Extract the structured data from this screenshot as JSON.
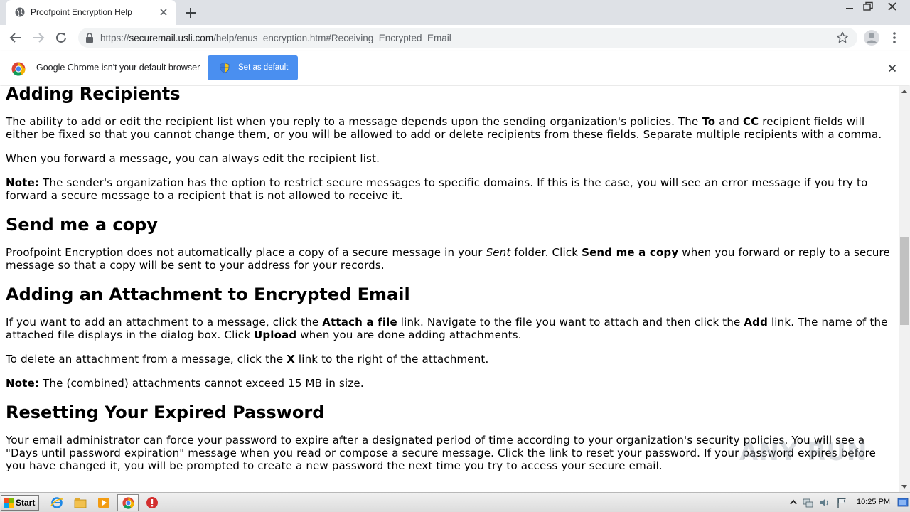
{
  "browser": {
    "tab": {
      "title": "Proofpoint Encryption Help"
    },
    "address": {
      "scheme": "https://",
      "host": "securemail.usli.com",
      "path": "/help/enus_encryption.htm#Receiving_Encrypted_Email"
    }
  },
  "infobar": {
    "message": "Google Chrome isn't your default browser",
    "button_label": "Set as default"
  },
  "content": {
    "sections": [
      {
        "heading": "Adding Recipients",
        "paragraphs": [
          {
            "a": "The ability to add or edit the recipient list when you reply to a message depends upon the sending organization's policies. The ",
            "b1": "To",
            "c": " and ",
            "b2": "CC",
            "d": " recipient fields will either be fixed so that you cannot change them, or you will be allowed to add or delete recipients from these fields. Separate multiple recipients with a comma."
          },
          {
            "text": "When you forward a message, you can always edit the recipient list."
          },
          {
            "label": "Note:",
            "text": " The sender's organization has the option to restrict secure messages to specific domains. If this is the case, you will see an error message if you try to forward a secure message to a recipient that is not allowed to receive it."
          }
        ]
      },
      {
        "heading": "Send me a copy",
        "paragraphs": [
          {
            "a": "Proofpoint Encryption does not automatically place a copy of a secure message in your ",
            "i1": "Sent",
            "c": " folder. Click ",
            "b1": "Send me a copy",
            "d": " when you forward or reply to a secure message so that a copy will be sent to your address for your records."
          }
        ]
      },
      {
        "heading": "Adding an Attachment to Encrypted Email",
        "paragraphs": [
          {
            "a": "If you want to add an attachment to a message, click the ",
            "b1": "Attach a file",
            "c": " link. Navigate to the file you want to attach and then click the ",
            "b2": "Add",
            "d": " link. The name of the attached file displays in the dialog box. Click ",
            "b3": "Upload",
            "e": " when you are done adding attachments."
          },
          {
            "a": "To delete an attachment from a message, click the ",
            "b1": "X",
            "c": " link to the right of the attachment."
          },
          {
            "label": "Note:",
            "text": " The (combined) attachments cannot exceed 15 MB in size."
          }
        ]
      },
      {
        "heading": "Resetting Your Expired Password",
        "paragraphs": [
          {
            "text": "Your email administrator can force your password to expire after a designated period of time according to your organization's security policies. You will see a \"Days until password expiration\" message when you read or compose a secure message. Click the link to reset your password. If your password expires before you have changed it, you will be prompted to create a new password the next time you try to access your secure email."
          }
        ]
      }
    ]
  },
  "watermark": {
    "text": "ANY RUN"
  },
  "taskbar": {
    "start_label": "Start",
    "clock": "10:25 PM"
  },
  "colors": {
    "tabstrip": "#dee1e6",
    "infobar_button": "#4a8ff0",
    "link_text": "#202124"
  }
}
